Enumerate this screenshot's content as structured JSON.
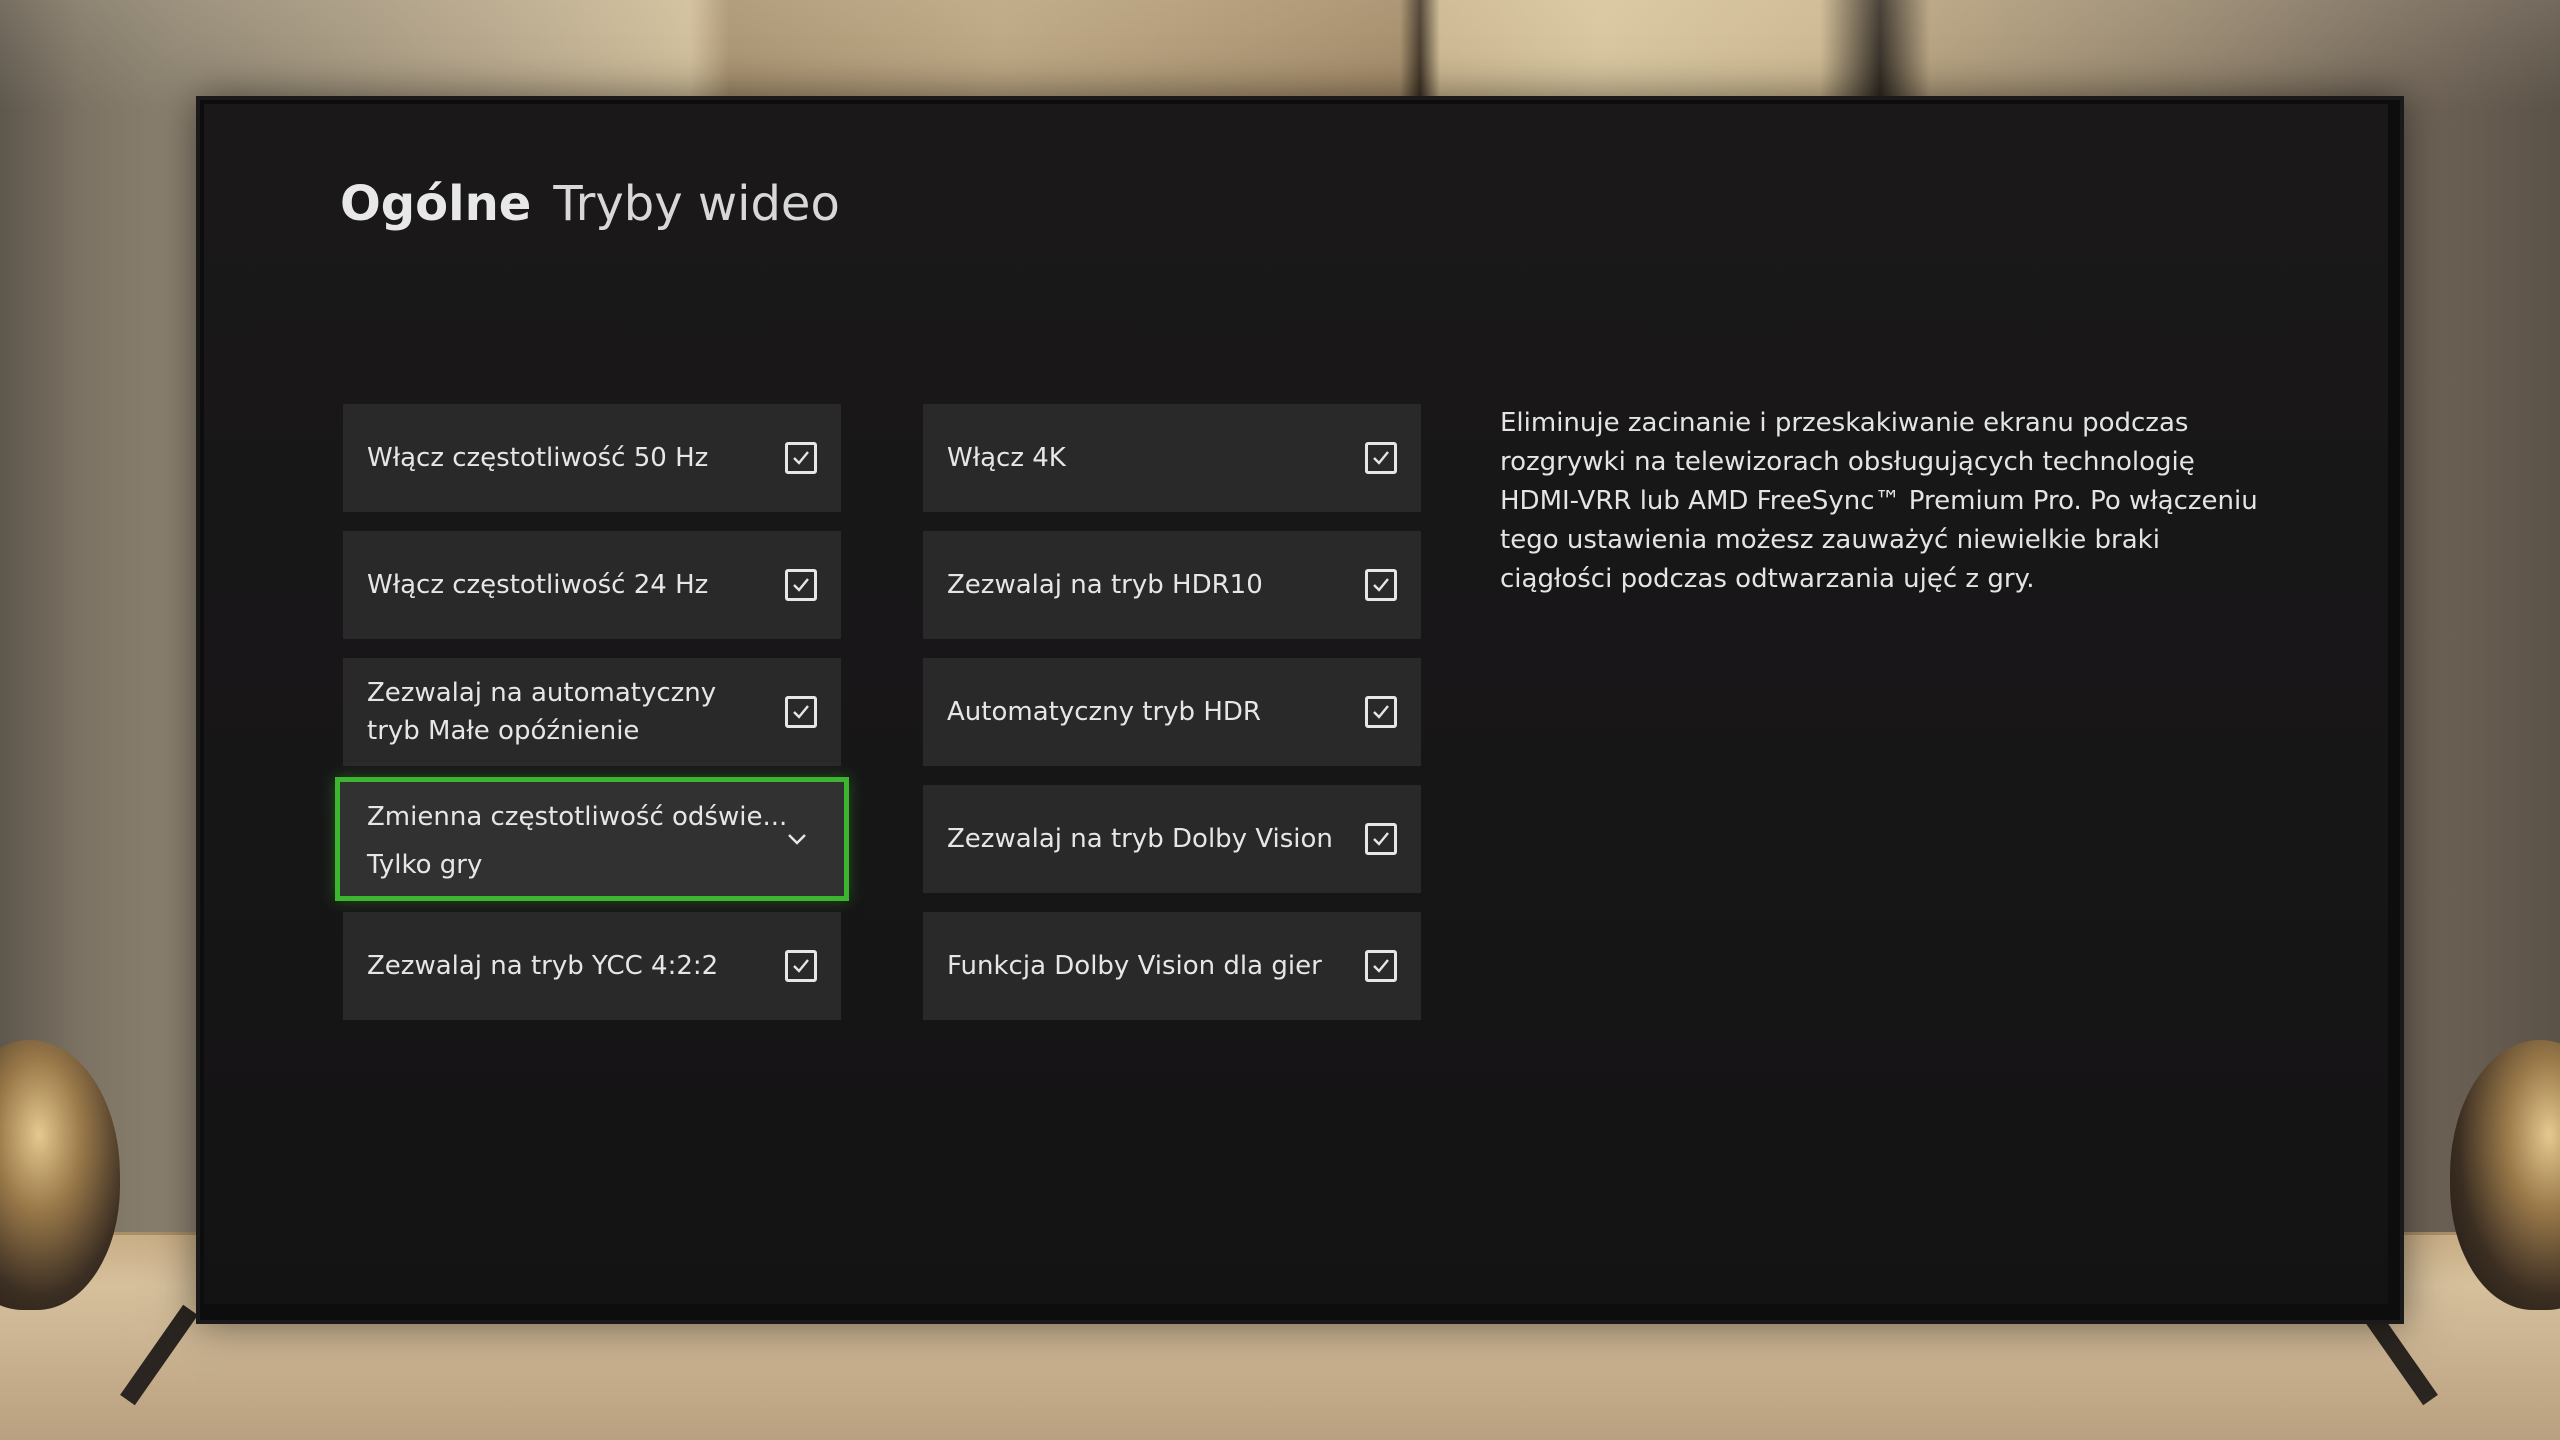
{
  "header": {
    "section": "Ogólne",
    "page": "Tryby wideo"
  },
  "left_column": [
    {
      "label": "Włącz częstotliwość 50 Hz",
      "checked": true
    },
    {
      "label": "Włącz częstotliwość 24 Hz",
      "checked": true
    },
    {
      "label": "Zezwalaj na automatyczny tryb Małe opóźnienie",
      "checked": true
    },
    {
      "label": "Zmienna częstotliwość odświe...",
      "value": "Tylko gry",
      "type": "dropdown",
      "focused": true
    },
    {
      "label": "Zezwalaj na tryb YCC 4:2:2",
      "checked": true
    }
  ],
  "right_column": [
    {
      "label": "Włącz 4K",
      "checked": true
    },
    {
      "label": "Zezwalaj na tryb HDR10",
      "checked": true
    },
    {
      "label": "Automatyczny tryb HDR",
      "checked": true
    },
    {
      "label": "Zezwalaj na tryb Dolby Vision",
      "checked": true
    },
    {
      "label": "Funkcja Dolby Vision dla gier",
      "checked": true
    }
  ],
  "description": "Eliminuje zacinanie i przeskakiwanie ekranu podczas rozgrywki na telewizorach obsługujących technologię HDMI-VRR lub AMD FreeSync™ Premium Pro. Po włączeniu tego ustawienia możesz zauważyć niewielkie braki ciągłości podczas odtwarzania ujęć z gry.",
  "colors": {
    "focus": "#3cb631",
    "tile": "#2a292a",
    "screen": "#171617",
    "text": "#e6e6e6"
  },
  "icons": {
    "checkbox": "checkbox-checked-icon",
    "dropdown": "chevron-down-icon"
  }
}
